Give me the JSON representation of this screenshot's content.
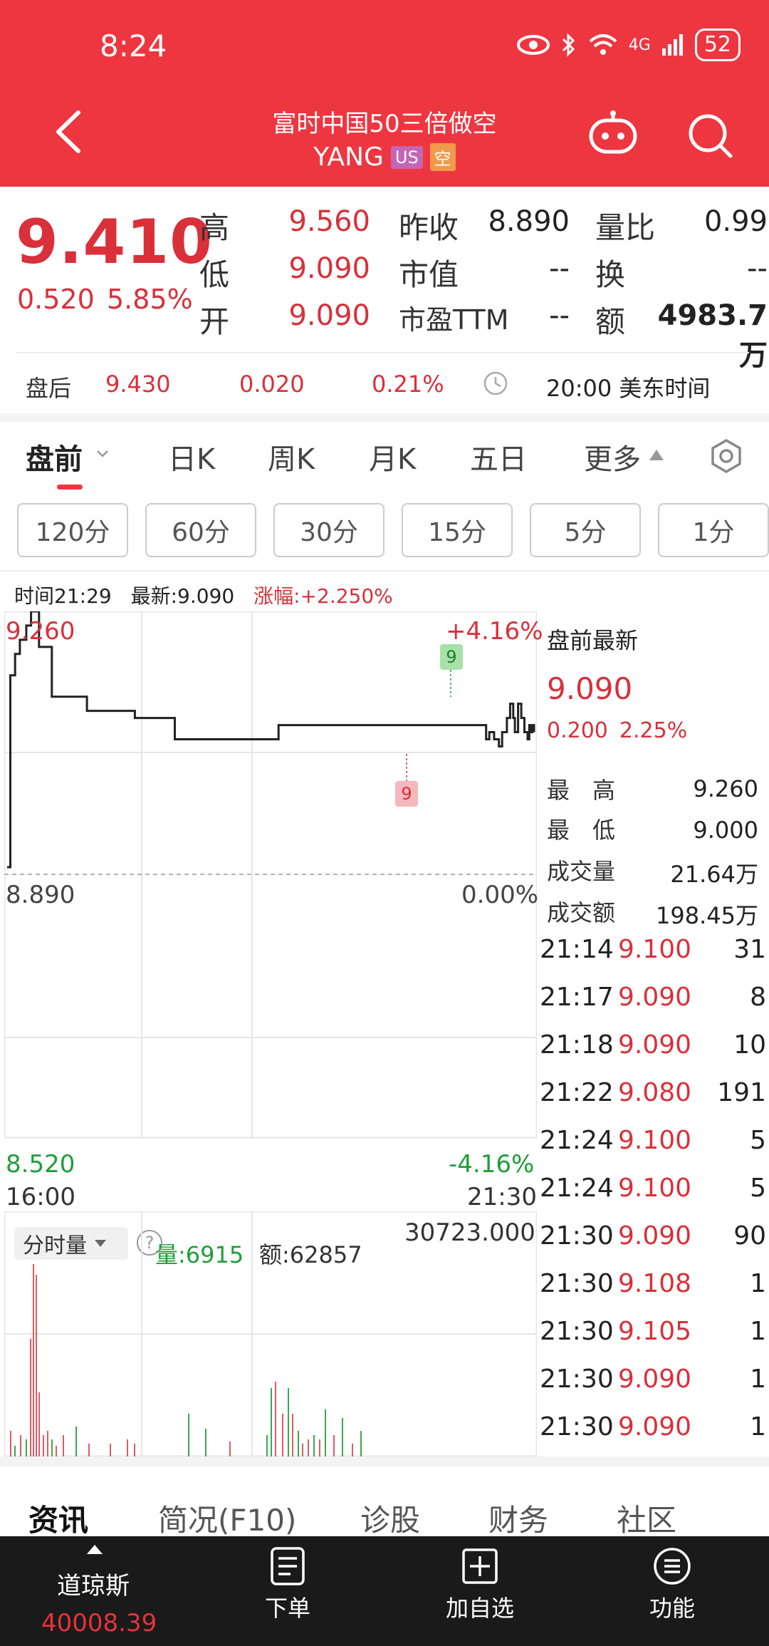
{
  "status_bar": {
    "time": "8:24",
    "network": "4G",
    "battery": "52"
  },
  "header": {
    "title": "富时中国50三倍做空",
    "ticker": "YANG",
    "badge_market": "US",
    "badge_type": "空"
  },
  "quote": {
    "price": "9.410",
    "change": "0.520",
    "change_pct": "5.85%",
    "stats": [
      {
        "label": "高",
        "value": "9.560"
      },
      {
        "label": "低",
        "value": "9.090"
      },
      {
        "label": "开",
        "value": "9.090"
      },
      {
        "label": "昨收",
        "value": "8.890"
      },
      {
        "label": "市值",
        "value": "--"
      },
      {
        "label": "市盈TTM",
        "value": "--"
      },
      {
        "label": "量比",
        "value": "0.99"
      },
      {
        "label": "换",
        "value": "--"
      },
      {
        "label": "额",
        "value": "4983.7万"
      }
    ]
  },
  "after_hours": {
    "label": "盘后",
    "price": "9.430",
    "change": "0.020",
    "change_pct": "0.21%",
    "time": "20:00 美东时间"
  },
  "chart_tabs": [
    "盘前",
    "日K",
    "周K",
    "月K",
    "五日",
    "更多"
  ],
  "intervals": [
    "120分",
    "60分",
    "30分",
    "15分",
    "5分",
    "1分"
  ],
  "chart_info": {
    "time": "时间21:29",
    "latest": "最新:9.090",
    "change": "涨幅:+2.250%"
  },
  "chart_labels": {
    "y_top": "9.260",
    "y_mid": "8.890",
    "y_bottom": "8.520",
    "pct_top": "+4.16%",
    "pct_mid": "0.00%",
    "pct_bottom": "-4.16%",
    "x_start": "16:00",
    "x_end": "21:30",
    "marker_high": "9",
    "marker_low": "9"
  },
  "chart_data": {
    "type": "line",
    "x": [
      "16:00",
      "16:02",
      "16:05",
      "16:08",
      "16:12",
      "16:15",
      "16:20",
      "16:28",
      "16:35",
      "16:50",
      "17:10",
      "17:20",
      "17:35",
      "17:45",
      "18:00",
      "18:30",
      "18:50",
      "19:00",
      "19:30",
      "20:00",
      "20:30",
      "20:55",
      "21:00",
      "21:02",
      "21:05",
      "21:08",
      "21:10",
      "21:13",
      "21:15",
      "21:17",
      "21:18",
      "21:20",
      "21:22",
      "21:24",
      "21:26",
      "21:27",
      "21:28",
      "21:29",
      "21:30"
    ],
    "y": [
      8.9,
      9.17,
      9.2,
      9.22,
      9.24,
      9.26,
      9.21,
      9.14,
      9.14,
      9.12,
      9.12,
      9.11,
      9.11,
      9.08,
      9.08,
      9.08,
      9.1,
      9.1,
      9.1,
      9.1,
      9.1,
      9.1,
      9.08,
      9.09,
      9.08,
      9.07,
      9.09,
      9.11,
      9.13,
      9.11,
      9.09,
      9.13,
      9.11,
      9.09,
      9.08,
      9.1,
      9.09,
      9.1,
      9.09
    ],
    "ylim": [
      8.52,
      9.26
    ],
    "reference": 8.89
  },
  "right_panel": {
    "title": "盘前最新",
    "price": "9.090",
    "change": "0.200",
    "change_pct": "2.25%",
    "stats": [
      {
        "label": "最　高",
        "value": "9.260"
      },
      {
        "label": "最　低",
        "value": "9.000"
      },
      {
        "label": "成交量",
        "value": "21.64万"
      },
      {
        "label": "成交额",
        "value": "198.45万"
      }
    ],
    "ticks": [
      {
        "time": "21:14",
        "price": "9.100",
        "vol": "31"
      },
      {
        "time": "21:17",
        "price": "9.090",
        "vol": "8"
      },
      {
        "time": "21:18",
        "price": "9.090",
        "vol": "10"
      },
      {
        "time": "21:22",
        "price": "9.080",
        "vol": "191"
      },
      {
        "time": "21:24",
        "price": "9.100",
        "vol": "5"
      },
      {
        "time": "21:24",
        "price": "9.100",
        "vol": "5"
      },
      {
        "time": "21:30",
        "price": "9.090",
        "vol": "90"
      },
      {
        "time": "21:30",
        "price": "9.108",
        "vol": "1"
      },
      {
        "time": "21:30",
        "price": "9.105",
        "vol": "1"
      },
      {
        "time": "21:30",
        "price": "9.090",
        "vol": "1"
      },
      {
        "time": "21:30",
        "price": "9.090",
        "vol": "1"
      }
    ]
  },
  "volume": {
    "toggle": "分时量",
    "help": "?",
    "vol_label": "量:6915",
    "amount_label": "额:62857",
    "max": "30723.000"
  },
  "news_tabs": [
    "资讯",
    "简况(F10)",
    "诊股",
    "财务",
    "社区"
  ],
  "bottom_nav": {
    "index_name": "道琼斯",
    "index_value": "40008.39",
    "items": [
      "下单",
      "加自选",
      "功能"
    ]
  },
  "colors": {
    "brand": "#ee3640",
    "up": "#d9303a",
    "down": "#1e9e3a"
  }
}
